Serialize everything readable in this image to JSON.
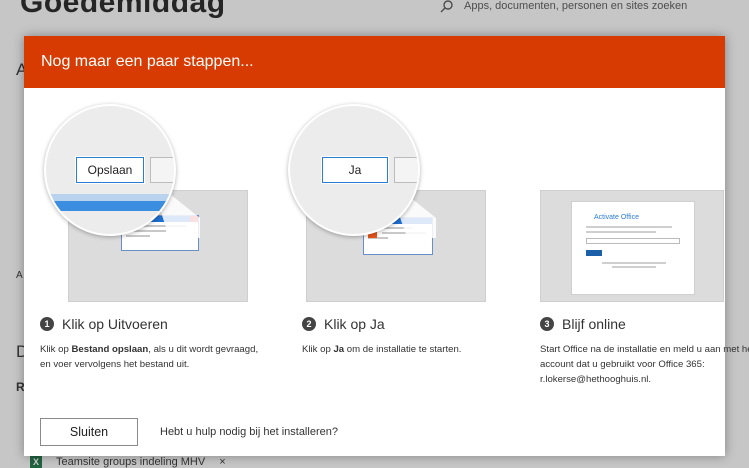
{
  "background": {
    "greeting": "Goedemiddag",
    "search_placeholder": "Apps, documenten, personen en sites zoeken",
    "left_letters": [
      "A",
      "A",
      "D",
      "R"
    ],
    "file_name": "Teamsite groups indeling MHV",
    "file_close": "×"
  },
  "dialog": {
    "title": "Nog maar een paar stappen...",
    "steps": [
      {
        "number": "1",
        "button_label": "Opslaan",
        "title": "Klik op Uitvoeren",
        "desc_pre": "Klik op ",
        "desc_bold": "Bestand opslaan",
        "desc_post": ", als u dit wordt gevraagd, en voer vervolgens het bestand uit."
      },
      {
        "number": "2",
        "button_label": "Ja",
        "title": "Klik op Ja",
        "desc_pre": "Klik op ",
        "desc_bold": "Ja",
        "desc_post": " om de installatie te starten."
      },
      {
        "number": "3",
        "screen_title": "Activate Office",
        "title": "Blijf online",
        "desc_pre": "Start Office na de installatie en meld u aan met het account dat u gebruikt voor Office 365: r.lokerse@hethooghuis.nl.",
        "desc_bold": "",
        "desc_post": ""
      }
    ],
    "close_label": "Sluiten",
    "help_text": "Hebt u hulp nodig bij het installeren?"
  },
  "colors": {
    "header": "#d83b01",
    "accent_blue": "#2b7cd3"
  }
}
